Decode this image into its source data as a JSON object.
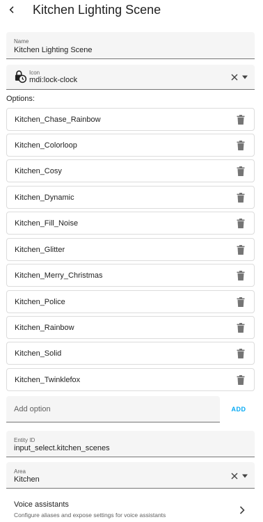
{
  "header": {
    "title": "Kitchen Lighting Scene",
    "back_icon": "arrow-left-icon"
  },
  "name_field": {
    "label": "Name",
    "value": "Kitchen Lighting Scene"
  },
  "icon_field": {
    "label": "Icon",
    "value": "mdi:lock-clock",
    "preview_icon": "lock-clock-icon"
  },
  "options": {
    "label": "Options:",
    "items": [
      {
        "label": "Kitchen_Chase_Rainbow"
      },
      {
        "label": "Kitchen_Colorloop"
      },
      {
        "label": "Kitchen_Cosy"
      },
      {
        "label": "Kitchen_Dynamic"
      },
      {
        "label": "Kitchen_Fill_Noise"
      },
      {
        "label": "Kitchen_Glitter"
      },
      {
        "label": "Kitchen_Merry_Christmas"
      },
      {
        "label": "Kitchen_Police"
      },
      {
        "label": "Kitchen_Rainbow"
      },
      {
        "label": "Kitchen_Solid"
      },
      {
        "label": "Kitchen_Twinklefox"
      }
    ]
  },
  "add_option": {
    "placeholder": "Add option",
    "value": "",
    "button_label": "ADD"
  },
  "entity_field": {
    "label": "Entity ID",
    "value": "input_select.kitchen_scenes"
  },
  "area_field": {
    "label": "Area",
    "value": "Kitchen"
  },
  "voice": {
    "title": "Voice assistants",
    "subtitle": "Configure aliases and expose settings for voice assistants"
  },
  "colors": {
    "accent": "#03a9f4",
    "field_bg": "#f5f5f5",
    "text": "#212121",
    "secondary_text": "#616161"
  }
}
